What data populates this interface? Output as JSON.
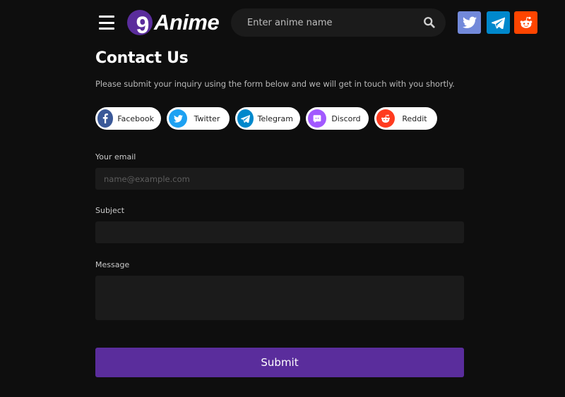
{
  "header": {
    "logo": {
      "digit": "9",
      "text": "Anime"
    },
    "search": {
      "placeholder": "Enter anime name",
      "value": ""
    },
    "social": [
      {
        "name": "twitter",
        "icon": "twitter-icon",
        "color": "#7289da"
      },
      {
        "name": "telegram",
        "icon": "telegram-icon",
        "color": "#0088cc"
      },
      {
        "name": "reddit",
        "icon": "reddit-icon",
        "color": "#ff4500"
      }
    ]
  },
  "page": {
    "title": "Contact Us",
    "description": "Please submit your inquiry using the form below and we will get in touch with you shortly."
  },
  "share": [
    {
      "label": "Facebook",
      "icon": "facebook-icon",
      "color": "#3b5998"
    },
    {
      "label": "Twitter",
      "icon": "twitter-icon",
      "color": "#1da1f2"
    },
    {
      "label": "Telegram",
      "icon": "telegram-icon",
      "color": "#0088cc"
    },
    {
      "label": "Discord",
      "icon": "discord-icon",
      "color": "#a259ff"
    },
    {
      "label": "Reddit",
      "icon": "reddit-icon",
      "color": "#ff3b1f"
    }
  ],
  "form": {
    "email": {
      "label": "Your email",
      "placeholder": "name@example.com",
      "value": ""
    },
    "subject": {
      "label": "Subject",
      "placeholder": "",
      "value": ""
    },
    "message": {
      "label": "Message",
      "placeholder": "",
      "value": ""
    },
    "submit_label": "Submit"
  },
  "colors": {
    "accent": "#5a2d9c",
    "background": "#0e0e0e",
    "input_bg": "#1b1b1b"
  }
}
